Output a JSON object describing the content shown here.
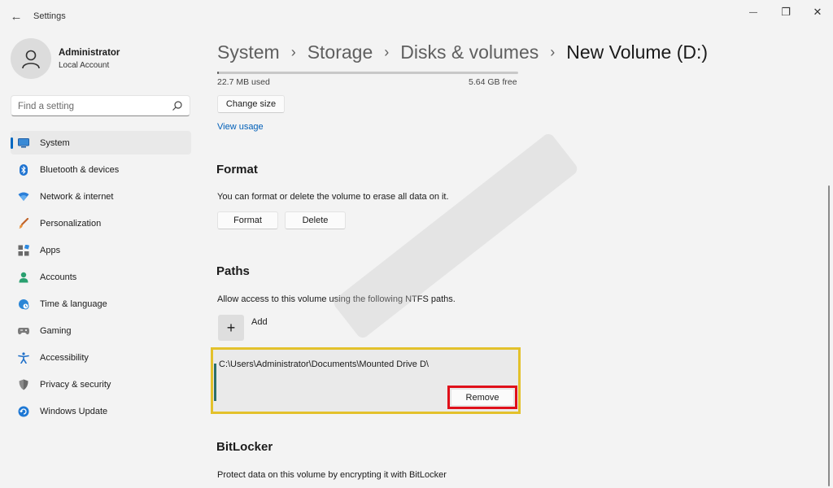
{
  "window": {
    "title": "Settings",
    "back_glyph": "←",
    "minimize_glyph": "—",
    "maximize_glyph": "❐",
    "close_glyph": "✕"
  },
  "profile": {
    "name": "Administrator",
    "account_type": "Local Account"
  },
  "search": {
    "placeholder": "Find a setting"
  },
  "sidebar": {
    "items": [
      {
        "label": "System",
        "icon": "monitor-icon",
        "active": true
      },
      {
        "label": "Bluetooth & devices",
        "icon": "bluetooth-icon"
      },
      {
        "label": "Network & internet",
        "icon": "wifi-icon"
      },
      {
        "label": "Personalization",
        "icon": "brush-icon"
      },
      {
        "label": "Apps",
        "icon": "apps-icon"
      },
      {
        "label": "Accounts",
        "icon": "person-icon"
      },
      {
        "label": "Time & language",
        "icon": "globe-clock-icon"
      },
      {
        "label": "Gaming",
        "icon": "gamepad-icon"
      },
      {
        "label": "Accessibility",
        "icon": "accessibility-icon"
      },
      {
        "label": "Privacy & security",
        "icon": "shield-icon"
      },
      {
        "label": "Windows Update",
        "icon": "update-icon"
      }
    ]
  },
  "breadcrumb": {
    "items": [
      "System",
      "Storage",
      "Disks & volumes",
      "New Volume (D:)"
    ],
    "separator": "›"
  },
  "storage": {
    "used": "22.7 MB used",
    "free": "5.64 GB free",
    "used_fraction": 0.004,
    "change_size_label": "Change size",
    "view_usage_label": "View usage"
  },
  "format": {
    "title": "Format",
    "description": "You can format or delete the volume to erase all data on it.",
    "format_label": "Format",
    "delete_label": "Delete"
  },
  "paths": {
    "title": "Paths",
    "description": "Allow access to this volume using the following NTFS paths.",
    "add_glyph": "+",
    "add_label": "Add",
    "entries": [
      "C:\\Users\\Administrator\\Documents\\Mounted Drive D\\"
    ],
    "remove_label": "Remove"
  },
  "bitlocker": {
    "title": "BitLocker",
    "description": "Protect data on this volume by encrypting it with BitLocker"
  },
  "colors": {
    "accent": "#0067c0",
    "highlight_yellow": "#e3c12b",
    "highlight_red": "#e0101a"
  }
}
